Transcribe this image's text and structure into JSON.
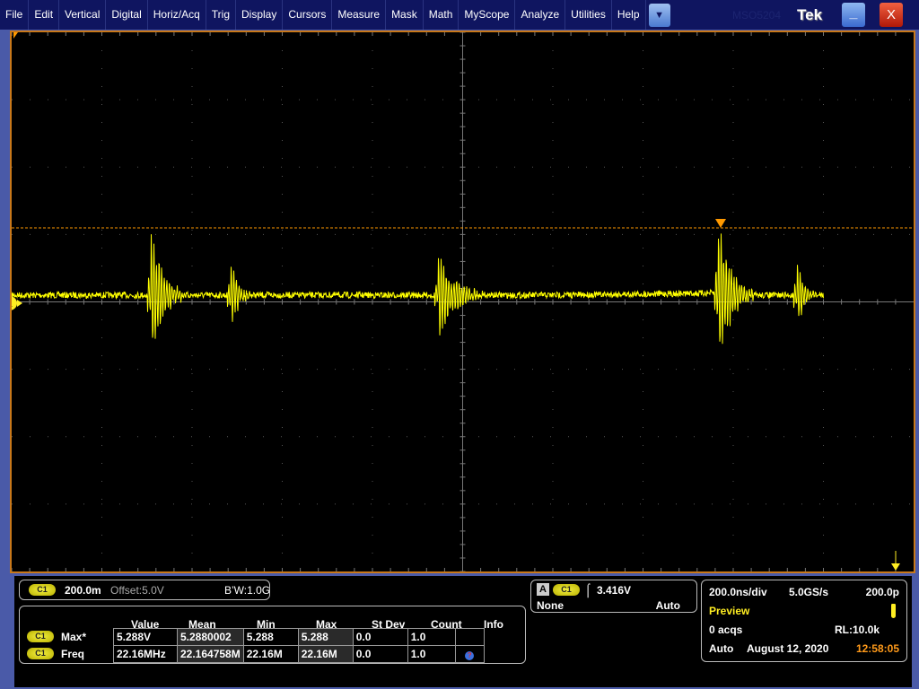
{
  "menu": [
    "File",
    "Edit",
    "Vertical",
    "Digital",
    "Horiz/Acq",
    "Trig",
    "Display",
    "Cursors",
    "Measure",
    "Mask",
    "Math",
    "MyScope",
    "Analyze",
    "Utilities",
    "Help"
  ],
  "title": {
    "model": "MSO5204",
    "brand": "Tek",
    "minimize": "_",
    "close": "X"
  },
  "scope": {
    "channel_marker": "1",
    "trace_color": "#ffff00",
    "trigger_color": "#ff9900"
  },
  "channel": {
    "badge": "C1",
    "scale": "200.0m",
    "offset": "Offset:5.0V",
    "bw": "B’W:1.0G"
  },
  "measurements": {
    "headers": [
      "Value",
      "Mean",
      "Min",
      "Max",
      "St Dev",
      "Count",
      "Info"
    ],
    "rows": [
      {
        "badge": "C1",
        "name": "Max*",
        "cells": [
          "5.288V",
          "5.2880002",
          "5.288",
          "5.288",
          "0.0",
          "1.0",
          ""
        ]
      },
      {
        "badge": "C1",
        "name": "Freq",
        "cells": [
          "22.16MHz",
          "22.164758M",
          "22.16M",
          "22.16M",
          "0.0",
          "1.0",
          "?"
        ]
      }
    ]
  },
  "trigger": {
    "label": "A",
    "badge": "C1",
    "level": "3.416V",
    "coupling": "None",
    "mode": "Auto"
  },
  "acq": {
    "timebase": "200.0ns/div",
    "rate": "5.0GS/s",
    "resolution": "200.0p",
    "state": "Preview",
    "acqs": "0 acqs",
    "rl": "RL:10.0k",
    "mode": "Auto",
    "date": "August 12, 2020",
    "time": "12:58:05"
  }
}
